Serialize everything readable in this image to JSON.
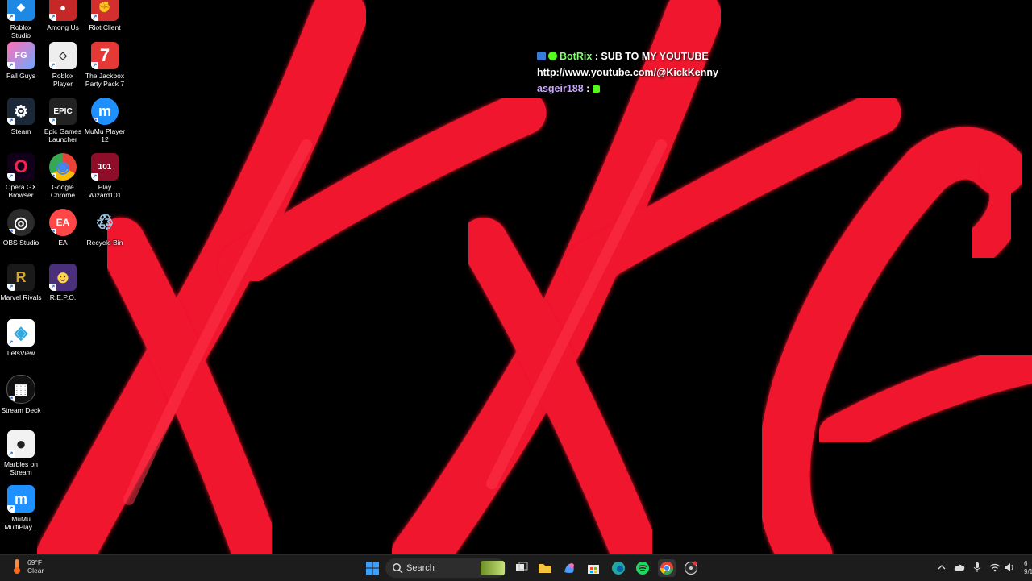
{
  "desktop": {
    "icons": [
      {
        "label": "Roblox Studio",
        "icon": "roblox-studio-icon",
        "color": "#1e88e5"
      },
      {
        "label": "Among Us",
        "icon": "among-us-icon",
        "color": "#c62828"
      },
      {
        "label": "Riot Client",
        "icon": "riot-client-icon",
        "color": "#d32f2f"
      },
      {
        "label": "Fall Guys",
        "icon": "fall-guys-icon",
        "color": "#e91e63"
      },
      {
        "label": "Roblox Player",
        "icon": "roblox-player-icon",
        "color": "#eeeeee"
      },
      {
        "label": "The Jackbox Party Pack 7",
        "icon": "jackbox-icon",
        "color": "#e53935"
      },
      {
        "label": "Steam",
        "icon": "steam-icon",
        "color": "#1b2838"
      },
      {
        "label": "Epic Games Launcher",
        "icon": "epic-games-icon",
        "color": "#222222"
      },
      {
        "label": "MuMu Player 12",
        "icon": "mumu-icon",
        "color": "#1e90ff"
      },
      {
        "label": "Opera GX Browser",
        "icon": "opera-gx-icon",
        "color": "#12001a"
      },
      {
        "label": "Google Chrome",
        "icon": "chrome-icon",
        "color": "#ffffff"
      },
      {
        "label": "Play Wizard101",
        "icon": "wizard101-icon",
        "color": "#8e0e2a"
      },
      {
        "label": "OBS Studio",
        "icon": "obs-icon",
        "color": "#2b2b2b"
      },
      {
        "label": "EA",
        "icon": "ea-icon",
        "color": "#ff4747"
      },
      {
        "label": "Recycle Bin",
        "icon": "recycle-bin-icon",
        "color": "#9ec9e8"
      },
      {
        "label": "Marvel Rivals",
        "icon": "marvel-rivals-icon",
        "color": "#d4a72c"
      },
      {
        "label": "R.E.P.O.",
        "icon": "repo-icon",
        "color": "#4a2f7a"
      },
      {
        "label": "LetsView",
        "icon": "letsview-icon",
        "color": "#ffffff"
      },
      {
        "label": "Stream Deck",
        "icon": "stream-deck-icon",
        "color": "#111111"
      },
      {
        "label": "Marbles on Stream",
        "icon": "marbles-icon",
        "color": "#f2f2f2"
      },
      {
        "label": "MuMu MultiPlay...",
        "icon": "mumu-multi-icon",
        "color": "#1e90ff"
      }
    ],
    "glyphs": {
      "roblox-studio": "◆",
      "among-us": "●",
      "riot-client": "✊",
      "fall-guys": "FG",
      "roblox-player": "◇",
      "jackbox": "7",
      "steam": "⚙",
      "epic": "EPIC",
      "mumu": "m",
      "opera": "O",
      "chrome": "◉",
      "wizard": "101",
      "obs": "◎",
      "ea": "EA",
      "recycle": "♲",
      "marvel": "R",
      "repo": "☻",
      "letsview": "◈",
      "streamdeck": "▦",
      "marbles": "●",
      "mumu-multi": "m"
    }
  },
  "chat": {
    "line1_user": "BotRix",
    "line1_sep": " : ",
    "line1_text": "SUB TO MY YOUTUBE",
    "line2_text": "http://www.youtube.com/@KickKenny",
    "line3_user": "asgeir188",
    "line3_sep": " : ",
    "colors": {
      "bot": "#7dff6b",
      "user": "#c9a7ff"
    }
  },
  "taskbar": {
    "weather_temp": "69°F",
    "weather_desc": "Clear",
    "search_placeholder": "Search",
    "clock_time": "6",
    "clock_date": "9/1"
  },
  "wallpaper": {
    "accent": "#f0182e"
  }
}
